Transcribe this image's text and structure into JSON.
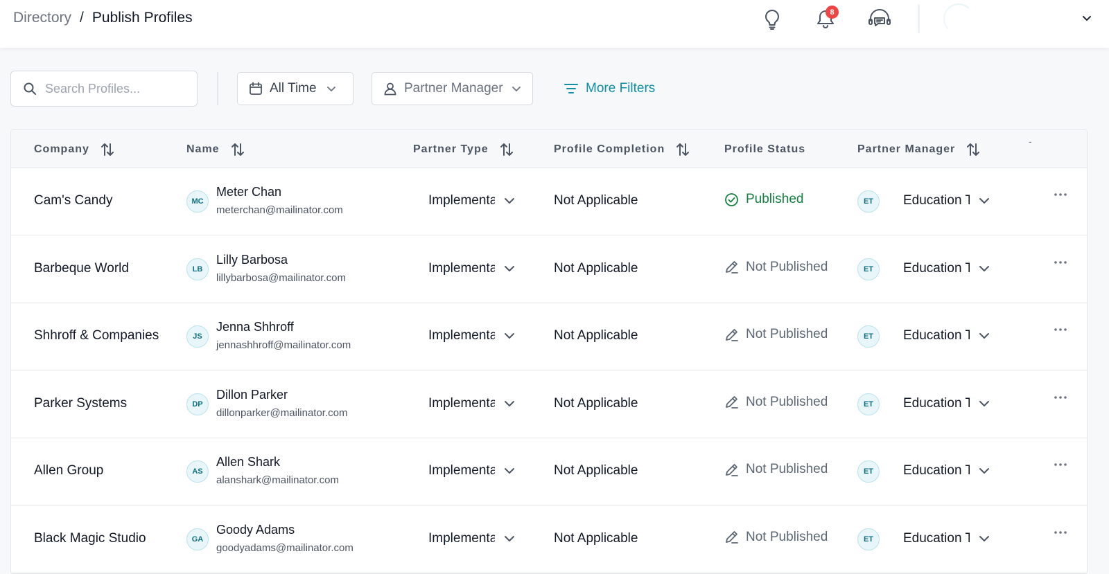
{
  "breadcrumb": {
    "parent": "Directory",
    "separator": "/",
    "current": "Publish Profiles"
  },
  "header": {
    "notification_count": "8"
  },
  "toolbar": {
    "search_placeholder": "Search Profiles...",
    "time_filter": "All Time",
    "manager_filter": "Partner Manager",
    "more_filters": "More Filters"
  },
  "table": {
    "columns": {
      "company": "Company",
      "name": "Name",
      "partner_type": "Partner Type",
      "profile_completion": "Profile Completion",
      "profile_status": "Profile Status",
      "partner_manager": "Partner Manager",
      "extra": "-"
    },
    "rows": [
      {
        "company": "Cam's Candy",
        "initials": "MC",
        "name": "Meter Chan",
        "email": "meterchan@mailinator.com",
        "partner_type": "Implementation",
        "completion": "Not Applicable",
        "status": "Published",
        "manager_initials": "ET",
        "manager": "Education Team"
      },
      {
        "company": "Barbeque World",
        "initials": "LB",
        "name": "Lilly Barbosa",
        "email": "lillybarbosa@mailinator.com",
        "partner_type": "Implementation",
        "completion": "Not Applicable",
        "status": "Not Published",
        "manager_initials": "ET",
        "manager": "Education Team"
      },
      {
        "company": "Shhroff & Companies",
        "initials": "JS",
        "name": "Jenna Shhroff",
        "email": "jennashhroff@mailinator.com",
        "partner_type": "Implementation",
        "completion": "Not Applicable",
        "status": "Not Published",
        "manager_initials": "ET",
        "manager": "Education Team"
      },
      {
        "company": "Parker Systems",
        "initials": "DP",
        "name": "Dillon Parker",
        "email": "dillonparker@mailinator.com",
        "partner_type": "Implementation",
        "completion": "Not Applicable",
        "status": "Not Published",
        "manager_initials": "ET",
        "manager": "Education Team"
      },
      {
        "company": "Allen Group",
        "initials": "AS",
        "name": "Allen Shark",
        "email": "alanshark@mailinator.com",
        "partner_type": "Implementation",
        "completion": "Not Applicable",
        "status": "Not Published",
        "manager_initials": "ET",
        "manager": "Education Team"
      },
      {
        "company": "Black Magic Studio",
        "initials": "GA",
        "name": "Goody Adams",
        "email": "goodyadams@mailinator.com",
        "partner_type": "Implementation",
        "completion": "Not Applicable",
        "status": "Not Published",
        "manager_initials": "ET",
        "manager": "Education Team"
      }
    ]
  },
  "colors": {
    "accent": "#0e8ea4",
    "published": "#13803d",
    "not_published": "#5b6775",
    "badge": "#ef4444"
  },
  "icons": [
    "lightbulb-icon",
    "bell-icon",
    "support-chat-icon",
    "search-icon",
    "calendar-icon",
    "person-icon",
    "filter-icon",
    "sort-icon",
    "chevron-down-icon",
    "check-circle-icon",
    "pencil-icon",
    "more-horizontal-icon"
  ]
}
